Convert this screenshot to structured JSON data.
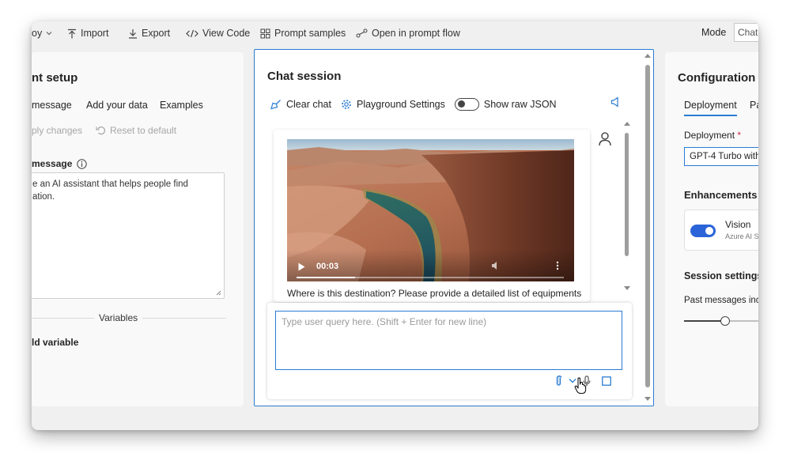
{
  "toolbar": {
    "deploy_label": "oy",
    "import_label": "Import",
    "export_label": "Export",
    "view_code_label": "View Code",
    "prompt_samples_label": "Prompt samples",
    "open_prompt_flow_label": "Open in prompt flow",
    "mode_label": "Mode",
    "mode_value": "Chat"
  },
  "assistant_setup": {
    "title": "nt setup",
    "tabs": [
      {
        "label": "message"
      },
      {
        "label": "Add your data"
      },
      {
        "label": "Examples"
      }
    ],
    "apply_changes_label": "ply changes",
    "reset_label": "Reset to default",
    "system_message_label": "message",
    "system_message_value": "e an AI assistant that helps people find\nation.",
    "variables_label": "Variables",
    "add_variable_label": "ld variable"
  },
  "chat_session": {
    "title": "Chat session",
    "clear_chat_label": "Clear chat",
    "playground_settings_label": "Playground Settings",
    "show_raw_json_label": "Show raw JSON",
    "video": {
      "time": "00:03",
      "progress": 0.22
    },
    "user_message": "Where is this destination? Please provide a detailed list of equipments",
    "query_placeholder": "Type user query here. (Shift + Enter for new line)"
  },
  "configuration": {
    "title": "Configuration",
    "tabs": [
      {
        "label": "Deployment"
      },
      {
        "label": "Pa"
      }
    ],
    "deployment_label": "Deployment",
    "deployment_required": "*",
    "deployment_value": "GPT-4 Turbo with",
    "enhancements_label": "Enhancements",
    "vision_title": "Vision",
    "vision_sub": "Azure AI S",
    "session_settings_label": "Session settings",
    "past_messages_label": "Past messages incl",
    "past_messages_slider": 0.43
  },
  "colors": {
    "accent": "#2b7cd3",
    "toggle_on": "#2b64d8",
    "panel_bg": "#f9f9f9",
    "window_bg": "#f0f0f0"
  }
}
